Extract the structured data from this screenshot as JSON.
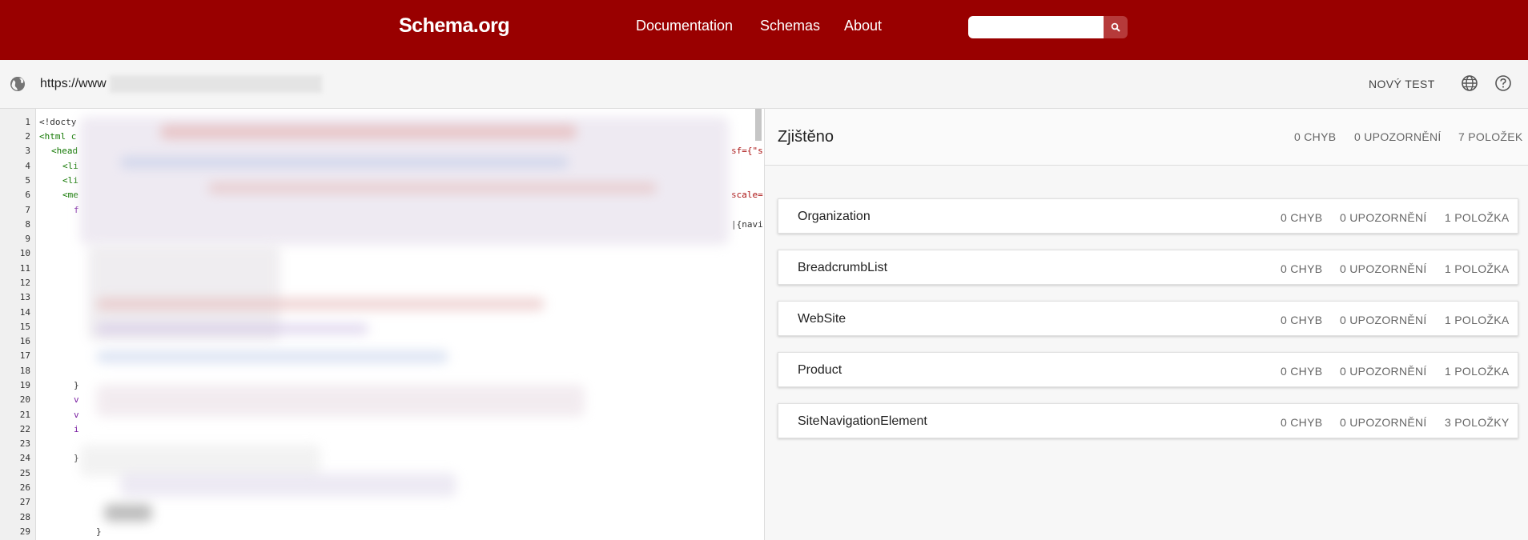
{
  "header": {
    "logo": "Schema.org",
    "nav": [
      "Documentation",
      "Schemas",
      "About"
    ],
    "search_placeholder": "",
    "search_icon": "search-icon",
    "brand_color": "#990000"
  },
  "urlbar": {
    "url_prefix": "https://www",
    "new_test": "NOVÝ TEST",
    "globe_icon": "globe-icon",
    "help_icon": "help-icon"
  },
  "code": {
    "line_numbers": [
      "1",
      "2",
      "3",
      "4",
      "5",
      "6",
      "7",
      "8",
      "9",
      "10",
      "11",
      "12",
      "13",
      "14",
      "15",
      "16",
      "17",
      "18",
      "19",
      "20",
      "21",
      "22",
      "23",
      "24",
      "25",
      "26",
      "27",
      "28",
      "29"
    ],
    "visible_fragments": {
      "l1": "<!docty",
      "l2": "<html c",
      "l3": "<head",
      "l4": "<li",
      "l5": "<li",
      "l6": "<me",
      "l7": "f",
      "l19": "}",
      "l20": "v",
      "l21": "v",
      "l22": "i",
      "l24": "}",
      "l29": "}",
      "r3": "sf={\"s",
      "r6": "scale=",
      "r8": "|{navi"
    }
  },
  "results": {
    "title": "Zjištěno",
    "errors": "0 CHYB",
    "warnings": "0 UPOZORNĚNÍ",
    "items": "7 POLOŽEK",
    "entries": [
      {
        "name": "Organization",
        "errors": "0 CHYB",
        "warnings": "0 UPOZORNĚNÍ",
        "items": "1 POLOŽKA"
      },
      {
        "name": "BreadcrumbList",
        "errors": "0 CHYB",
        "warnings": "0 UPOZORNĚNÍ",
        "items": "1 POLOŽKA"
      },
      {
        "name": "WebSite",
        "errors": "0 CHYB",
        "warnings": "0 UPOZORNĚNÍ",
        "items": "1 POLOŽKA"
      },
      {
        "name": "Product",
        "errors": "0 CHYB",
        "warnings": "0 UPOZORNĚNÍ",
        "items": "1 POLOŽKA"
      },
      {
        "name": "SiteNavigationElement",
        "errors": "0 CHYB",
        "warnings": "0 UPOZORNĚNÍ",
        "items": "3 POLOŽKY"
      }
    ]
  }
}
